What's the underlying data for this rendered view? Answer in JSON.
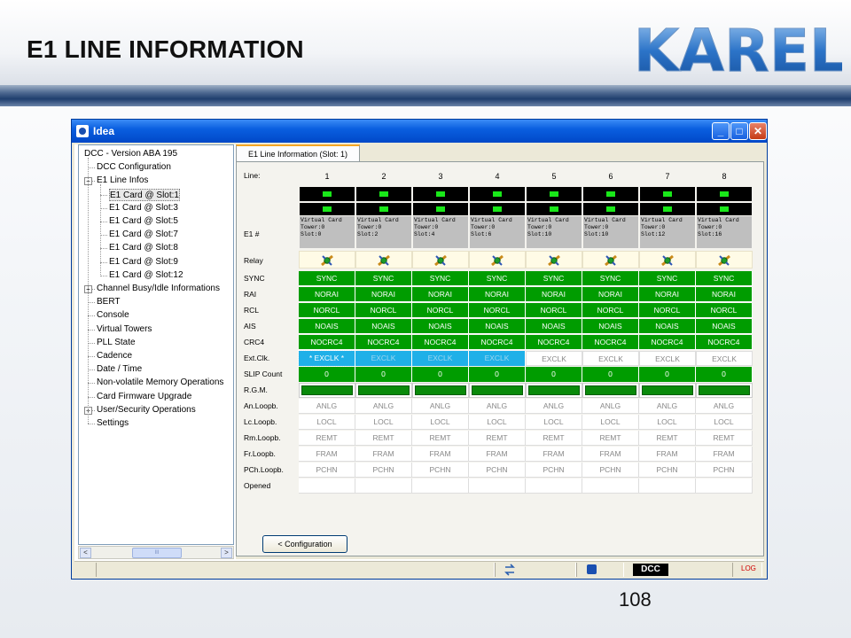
{
  "slide": {
    "title": "E1 LINE INFORMATION",
    "logo_text": "KAREL",
    "page_number": "108"
  },
  "window": {
    "title": "Idea",
    "buttons": {
      "minimize": "_",
      "maximize": "□",
      "close": "✕"
    }
  },
  "tree": {
    "items": [
      {
        "label": "DCC - Version ABA 195",
        "level": 0,
        "expander": ""
      },
      {
        "label": "DCC Configuration",
        "level": 1,
        "expander": ""
      },
      {
        "label": "E1 Line Infos",
        "level": 1,
        "expander": "−"
      },
      {
        "label": "E1 Card @ Slot:1",
        "level": 2,
        "expander": "",
        "selected": true
      },
      {
        "label": "E1 Card @ Slot:3",
        "level": 2,
        "expander": ""
      },
      {
        "label": "E1 Card @ Slot:5",
        "level": 2,
        "expander": ""
      },
      {
        "label": "E1 Card @ Slot:7",
        "level": 2,
        "expander": ""
      },
      {
        "label": "E1 Card @ Slot:8",
        "level": 2,
        "expander": ""
      },
      {
        "label": "E1 Card @ Slot:9",
        "level": 2,
        "expander": ""
      },
      {
        "label": "E1 Card @ Slot:12",
        "level": 2,
        "expander": ""
      },
      {
        "label": "Channel Busy/Idle Informations",
        "level": 1,
        "expander": "+"
      },
      {
        "label": "BERT",
        "level": 1,
        "expander": ""
      },
      {
        "label": "Console",
        "level": 1,
        "expander": ""
      },
      {
        "label": "Virtual Towers",
        "level": 1,
        "expander": ""
      },
      {
        "label": "PLL State",
        "level": 1,
        "expander": ""
      },
      {
        "label": "Cadence",
        "level": 1,
        "expander": ""
      },
      {
        "label": "Date / Time",
        "level": 1,
        "expander": ""
      },
      {
        "label": "Non-volatile Memory Operations",
        "level": 1,
        "expander": ""
      },
      {
        "label": "Card Firmware Upgrade",
        "level": 1,
        "expander": ""
      },
      {
        "label": "User/Security Operations",
        "level": 1,
        "expander": "+"
      },
      {
        "label": "Settings",
        "level": 1,
        "expander": ""
      }
    ],
    "scroll_left": "<",
    "scroll_right": ">",
    "scroll_grip": "III"
  },
  "tab": {
    "label": "E1 Line Information (Slot: 1)"
  },
  "grid": {
    "line_label": "Line:",
    "lines": [
      "1",
      "2",
      "3",
      "4",
      "5",
      "6",
      "7",
      "8"
    ],
    "e1_label": "E1 #",
    "e1_info": [
      "Virtual Card\nTower:0\nSlot:0",
      "Virtual Card\nTower:0\nSlot:2",
      "Virtual Card\nTower:0\nSlot:4",
      "Virtual Card\nTower:0\nSlot:6",
      "Virtual Card\nTower:0\nSlot:10",
      "Virtual Card\nTower:0\nSlot:10",
      "Virtual Card\nTower:0\nSlot:12",
      "Virtual Card\nTower:0\nSlot:16"
    ],
    "relay_label": "Relay",
    "rows": [
      {
        "label": "SYNC",
        "style": "green",
        "values": [
          "SYNC",
          "SYNC",
          "SYNC",
          "SYNC",
          "SYNC",
          "SYNC",
          "SYNC",
          "SYNC"
        ]
      },
      {
        "label": "RAI",
        "style": "green",
        "values": [
          "NORAI",
          "NORAI",
          "NORAI",
          "NORAI",
          "NORAI",
          "NORAI",
          "NORAI",
          "NORAI"
        ]
      },
      {
        "label": "RCL",
        "style": "green",
        "values": [
          "NORCL",
          "NORCL",
          "NORCL",
          "NORCL",
          "NORCL",
          "NORCL",
          "NORCL",
          "NORCL"
        ]
      },
      {
        "label": "AIS",
        "style": "green",
        "values": [
          "NOAIS",
          "NOAIS",
          "NOAIS",
          "NOAIS",
          "NOAIS",
          "NOAIS",
          "NOAIS",
          "NOAIS"
        ]
      },
      {
        "label": "CRC4",
        "style": "green",
        "values": [
          "NOCRC4",
          "NOCRC4",
          "NOCRC4",
          "NOCRC4",
          "NOCRC4",
          "NOCRC4",
          "NOCRC4",
          "NOCRC4"
        ]
      },
      {
        "label": "Ext.Clk.",
        "style": "extclk",
        "values": [
          "* EXCLK *",
          "EXCLK",
          "EXCLK",
          "EXCLK",
          "EXCLK",
          "EXCLK",
          "EXCLK",
          "EXCLK"
        ]
      },
      {
        "label": "SLIP Count",
        "style": "slip",
        "values": [
          "0",
          "0",
          "0",
          "0",
          "0",
          "0",
          "0",
          "0"
        ]
      },
      {
        "label": "R.G.M.",
        "style": "rgm",
        "values": [
          "",
          "",
          "",
          "",
          "",
          "",
          "",
          ""
        ]
      },
      {
        "label": "An.Loopb.",
        "style": "white",
        "values": [
          "ANLG",
          "ANLG",
          "ANLG",
          "ANLG",
          "ANLG",
          "ANLG",
          "ANLG",
          "ANLG"
        ]
      },
      {
        "label": "Lc.Loopb.",
        "style": "white",
        "values": [
          "LOCL",
          "LOCL",
          "LOCL",
          "LOCL",
          "LOCL",
          "LOCL",
          "LOCL",
          "LOCL"
        ]
      },
      {
        "label": "Rm.Loopb.",
        "style": "white",
        "values": [
          "REMT",
          "REMT",
          "REMT",
          "REMT",
          "REMT",
          "REMT",
          "REMT",
          "REMT"
        ]
      },
      {
        "label": "Fr.Loopb.",
        "style": "white",
        "values": [
          "FRAM",
          "FRAM",
          "FRAM",
          "FRAM",
          "FRAM",
          "FRAM",
          "FRAM",
          "FRAM"
        ]
      },
      {
        "label": "PCh.Loopb.",
        "style": "white",
        "values": [
          "PCHN",
          "PCHN",
          "PCHN",
          "PCHN",
          "PCHN",
          "PCHN",
          "PCHN",
          "PCHN"
        ]
      },
      {
        "label": "Opened",
        "style": "blank",
        "values": [
          "",
          "",
          "",
          "",
          "",
          "",
          "",
          ""
        ]
      }
    ]
  },
  "config_button": "< Configuration",
  "statusbar": {
    "dcc": "DCC",
    "log": "LOG"
  }
}
